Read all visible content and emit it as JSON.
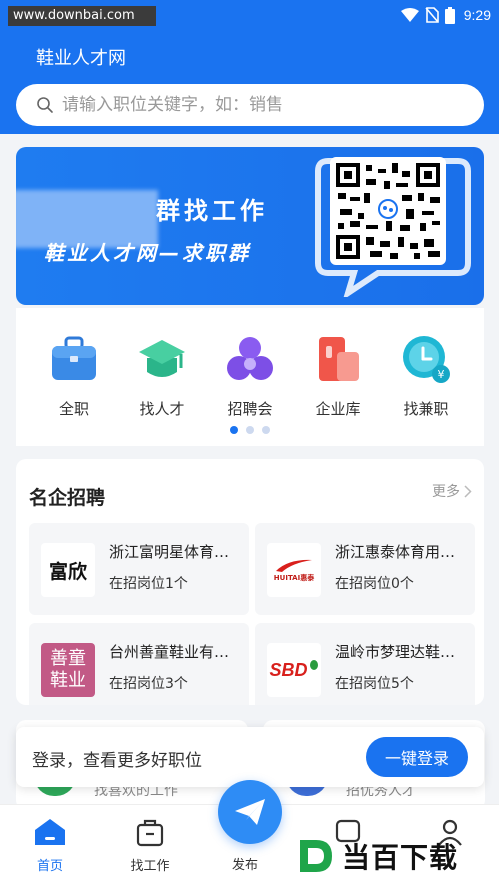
{
  "status_bar": {
    "watermark": "www.downbai.com",
    "time": "9:29"
  },
  "header": {
    "title": "鞋业人才网"
  },
  "search": {
    "placeholder": "请输入职位关键字，如：销售"
  },
  "banner": {
    "line1": "群找工作",
    "line2": "鞋业人才网—求职群"
  },
  "categories": [
    {
      "label": "全职",
      "icon": "briefcase-icon"
    },
    {
      "label": "找人才",
      "icon": "graduation-cap-icon"
    },
    {
      "label": "招聘会",
      "icon": "group-icon"
    },
    {
      "label": "企业库",
      "icon": "company-icon"
    },
    {
      "label": "找兼职",
      "icon": "part-time-icon"
    }
  ],
  "companies": {
    "title": "名企招聘",
    "more": "更多",
    "items": [
      {
        "name": "浙江富明星体育用品有限公司",
        "jobs": "在招岗位1个",
        "logo_text": "富欣"
      },
      {
        "name": "浙江惠泰体育用品有限公司",
        "jobs": "在招岗位0个",
        "logo_text": "HUITAI惠泰"
      },
      {
        "name": "台州善童鞋业有限公司",
        "jobs": "在招岗位3个",
        "logo_text": "善童鞋业"
      },
      {
        "name": "温岭市梦理达鞋业有限公司",
        "jobs": "在招岗位5个",
        "logo_text": "SBD"
      }
    ]
  },
  "peek": {
    "left_text": "找喜欢的工作",
    "right_text": "招优秀人才"
  },
  "login_prompt": {
    "text": "登录，查看更多好职位",
    "button": "一键登录"
  },
  "nav": {
    "home": "首页",
    "jobs": "找工作",
    "publish": "发布",
    "brand": "当百下载"
  },
  "colors": {
    "primary": "#1a73f0"
  }
}
